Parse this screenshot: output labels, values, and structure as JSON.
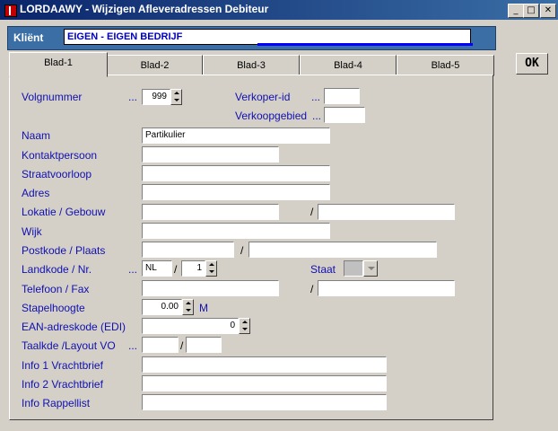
{
  "window": {
    "title": "LORDAAWY - Wijzigen Afleveradressen Debiteur",
    "min_glyph": "_",
    "max_glyph": "□",
    "close_glyph": "✕"
  },
  "client": {
    "label": "Kliënt",
    "value": "EIGEN - EIGEN BEDRIJF"
  },
  "ok_label": "OK",
  "tabs": [
    "Blad-1",
    "Blad-2",
    "Blad-3",
    "Blad-4",
    "Blad-5"
  ],
  "fields": {
    "volgnummer": {
      "label": "Volgnummer",
      "dots": "...",
      "value": "999"
    },
    "verkoper": {
      "label": "Verkoper-id",
      "dots": "...",
      "value": ""
    },
    "verkoopgebied": {
      "label": "Verkoopgebied",
      "dots": "...",
      "value": ""
    },
    "naam": {
      "label": "Naam",
      "value": "Partikulier"
    },
    "kontakt": {
      "label": "Kontaktpersoon",
      "value": ""
    },
    "straat": {
      "label": "Straatvoorloop",
      "value": ""
    },
    "adres": {
      "label": "Adres",
      "value": ""
    },
    "lokatie": {
      "label": "Lokatie / Gebouw",
      "value1": "",
      "value2": ""
    },
    "wijk": {
      "label": "Wijk",
      "value": ""
    },
    "postkode": {
      "label": "Postkode / Plaats",
      "value1": "",
      "value2": ""
    },
    "landkode": {
      "label": "Landkode  / Nr.",
      "dots": "...",
      "value1": "NL",
      "value2": "1"
    },
    "staat": {
      "label": "Staat",
      "value": ""
    },
    "telefoon": {
      "label": "Telefoon / Fax",
      "value1": "",
      "value2": ""
    },
    "stapelhoogte": {
      "label": "Stapelhoogte",
      "value": "0.00",
      "unit": "M"
    },
    "ean": {
      "label": "EAN-adreskode (EDI)",
      "value": "0"
    },
    "taalkde": {
      "label": "Taalkde /Layout VO",
      "dots": "...",
      "value1": "",
      "value2": ""
    },
    "info1": {
      "label": "Info 1 Vrachtbrief",
      "value": ""
    },
    "info2": {
      "label": "Info 2 Vrachtbrief",
      "value": ""
    },
    "info_rappel": {
      "label": "Info Rappellist",
      "value": ""
    }
  },
  "slash": "/",
  "colors": {
    "label": "#1010b0",
    "titlebar": "#0a246a",
    "client_bar": "#3a6ea5"
  }
}
